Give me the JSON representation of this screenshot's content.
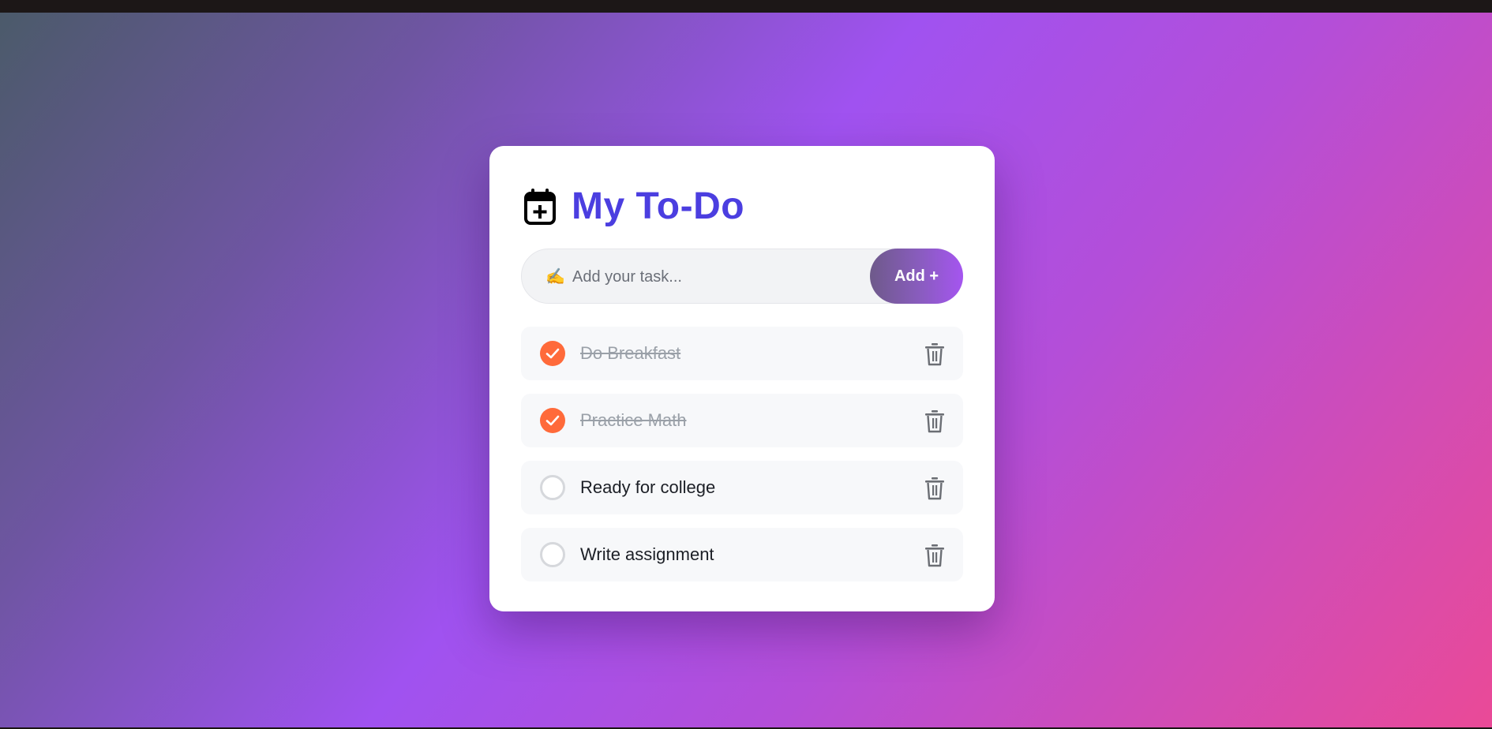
{
  "app": {
    "title": "My To-Do",
    "header_icon": "calendar-plus-icon"
  },
  "input": {
    "placeholder": "Add your task...",
    "value": "",
    "prefix_icon": "✍️",
    "add_label": "Add +"
  },
  "tasks": [
    {
      "text": "Do Breakfast",
      "completed": true
    },
    {
      "text": "Practice Math",
      "completed": true
    },
    {
      "text": "Ready for college",
      "completed": false
    },
    {
      "text": "Write assignment",
      "completed": false
    }
  ],
  "colors": {
    "title": "#4b3ee0",
    "check_done": "#ff6a3a",
    "add_button_gradient_start": "#6e5a8a",
    "add_button_gradient_end": "#a555f0",
    "background_gradient": [
      "#4b5a6a",
      "#a052f0",
      "#ea4a97"
    ]
  }
}
